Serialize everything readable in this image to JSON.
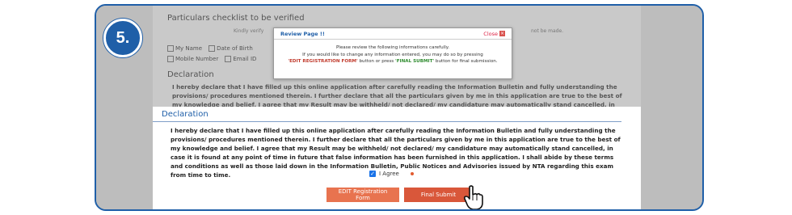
{
  "step_badge": "5.",
  "checklist": {
    "title": "Particulars checklist to be verified",
    "instruction_start": "Kindly verify",
    "instruction_end": "not be made.",
    "row1": [
      "My Name",
      "Date of Birth"
    ],
    "row2": [
      "Mobile Number",
      "Email ID"
    ]
  },
  "declaration": {
    "title": "Declaration",
    "text": "I hereby declare that I have filled up this online application after carefully reading the Information Bulletin and fully understanding the provisions/ procedures mentioned therein. I further declare that all the particulars given by me in this application are true to the best of my knowledge and belief. I agree that my Result may be withheld/ not declared/ my candidature may automatically stand cancelled, in case it is found at any point of time in future that false information has been furnished in this application. I shall abide by these terms and conditions as well as those laid down in the Information Bulletin, Public Notices and Advisories issued by NTA regarding this exam from time to time.",
    "agree_label": "I Agree"
  },
  "buttons": {
    "edit": "EDIT Registration Form",
    "submit": "Final Submit"
  },
  "modal": {
    "title": "Review Page !!",
    "close": "Close",
    "line1": "Please review the following informations carefully.",
    "line2": "If you would like to change any information entered, you may do so by pressing",
    "edit_ref": "'EDIT REGISTRATION FORM'",
    "mid": " button or press ",
    "final_ref": "'FINAL SUBMIT'",
    "end": " button for final submission."
  },
  "colors": {
    "accent": "#1f5fa8",
    "edit_button": "#e8734f",
    "submit_button": "#d9573a"
  }
}
